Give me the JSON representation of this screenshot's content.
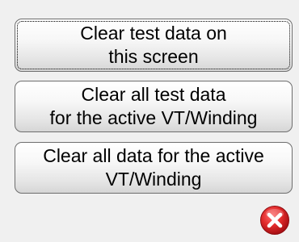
{
  "buttons": {
    "clear_screen": {
      "line1": "Clear test data on",
      "line2": "this screen"
    },
    "clear_all_test": {
      "line1": "Clear all test data",
      "line2": "for the active VT/Winding"
    },
    "clear_all_data": {
      "line1": "Clear all data for the active",
      "line2": "VT/Winding"
    }
  },
  "close": {
    "icon": "close-icon",
    "color": "#d61f26"
  },
  "colors": {
    "background": "#f0f0f0",
    "button_border": "#6e6e6e",
    "close_red": "#d61f26"
  }
}
